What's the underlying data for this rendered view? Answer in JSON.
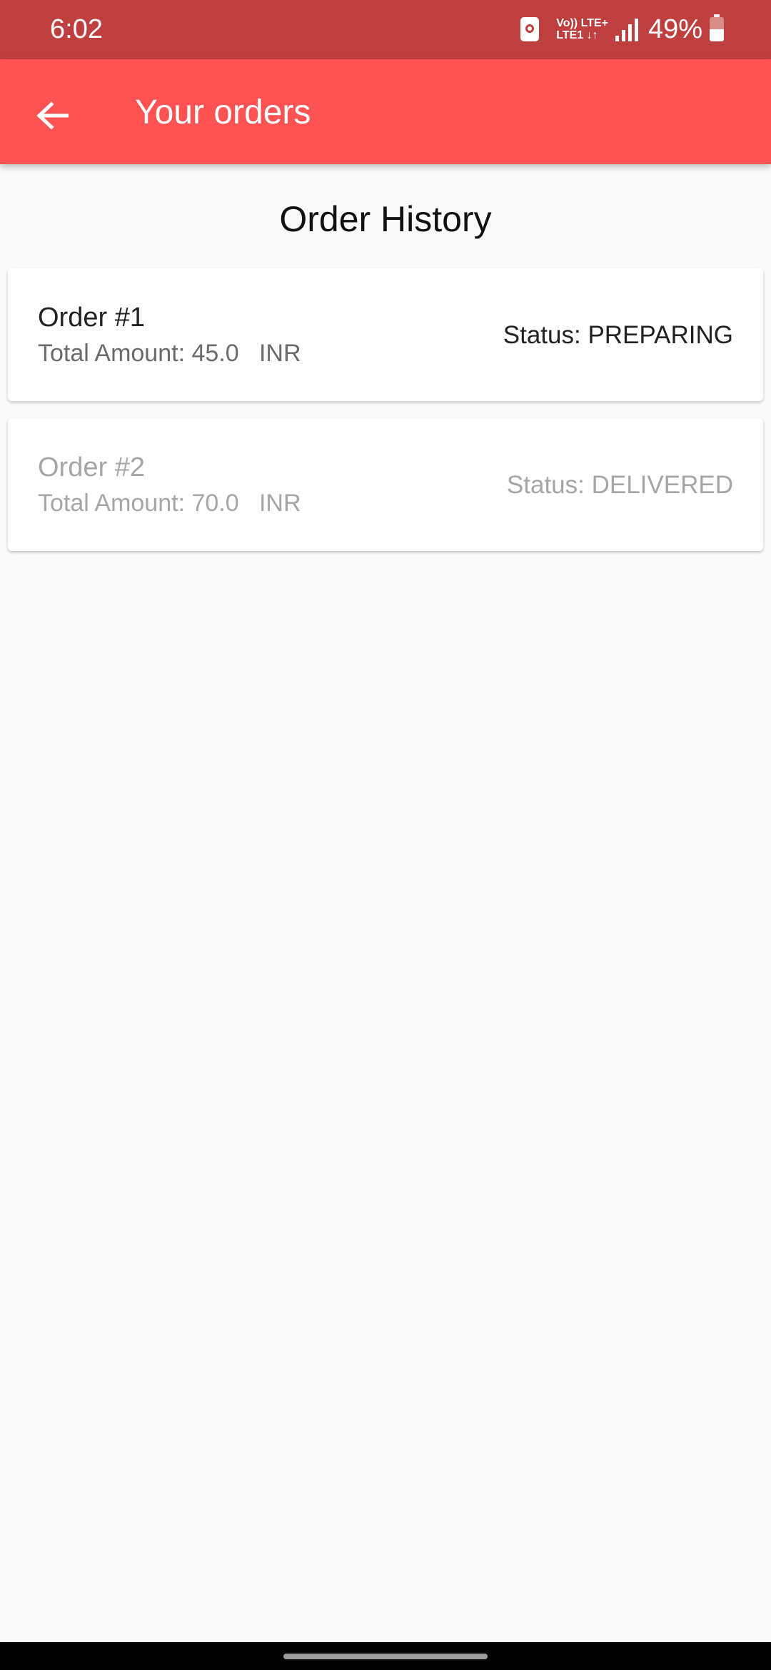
{
  "status_bar": {
    "time": "6:02",
    "network_line1": "Vo)) LTE+",
    "network_line2": "LTE1 ↓↑",
    "battery_percent": "49%",
    "battery_level": 0.49
  },
  "app_bar": {
    "title": "Your orders",
    "back_icon": "arrow-back-icon"
  },
  "page": {
    "section_title": "Order History"
  },
  "orders": [
    {
      "number": "Order #1",
      "amount": "Total Amount: 45.0   INR",
      "status": "Status: PREPARING"
    },
    {
      "number": "Order #2",
      "amount": "Total Amount: 70.0   INR",
      "status": "Status: DELIVERED"
    }
  ],
  "colors": {
    "status_bar": "#bf3e3e",
    "app_bar": "#ff5252",
    "background": "#fafafa",
    "card": "#ffffff",
    "active_text": "#222222",
    "inactive_text": "#a6a6a6"
  }
}
